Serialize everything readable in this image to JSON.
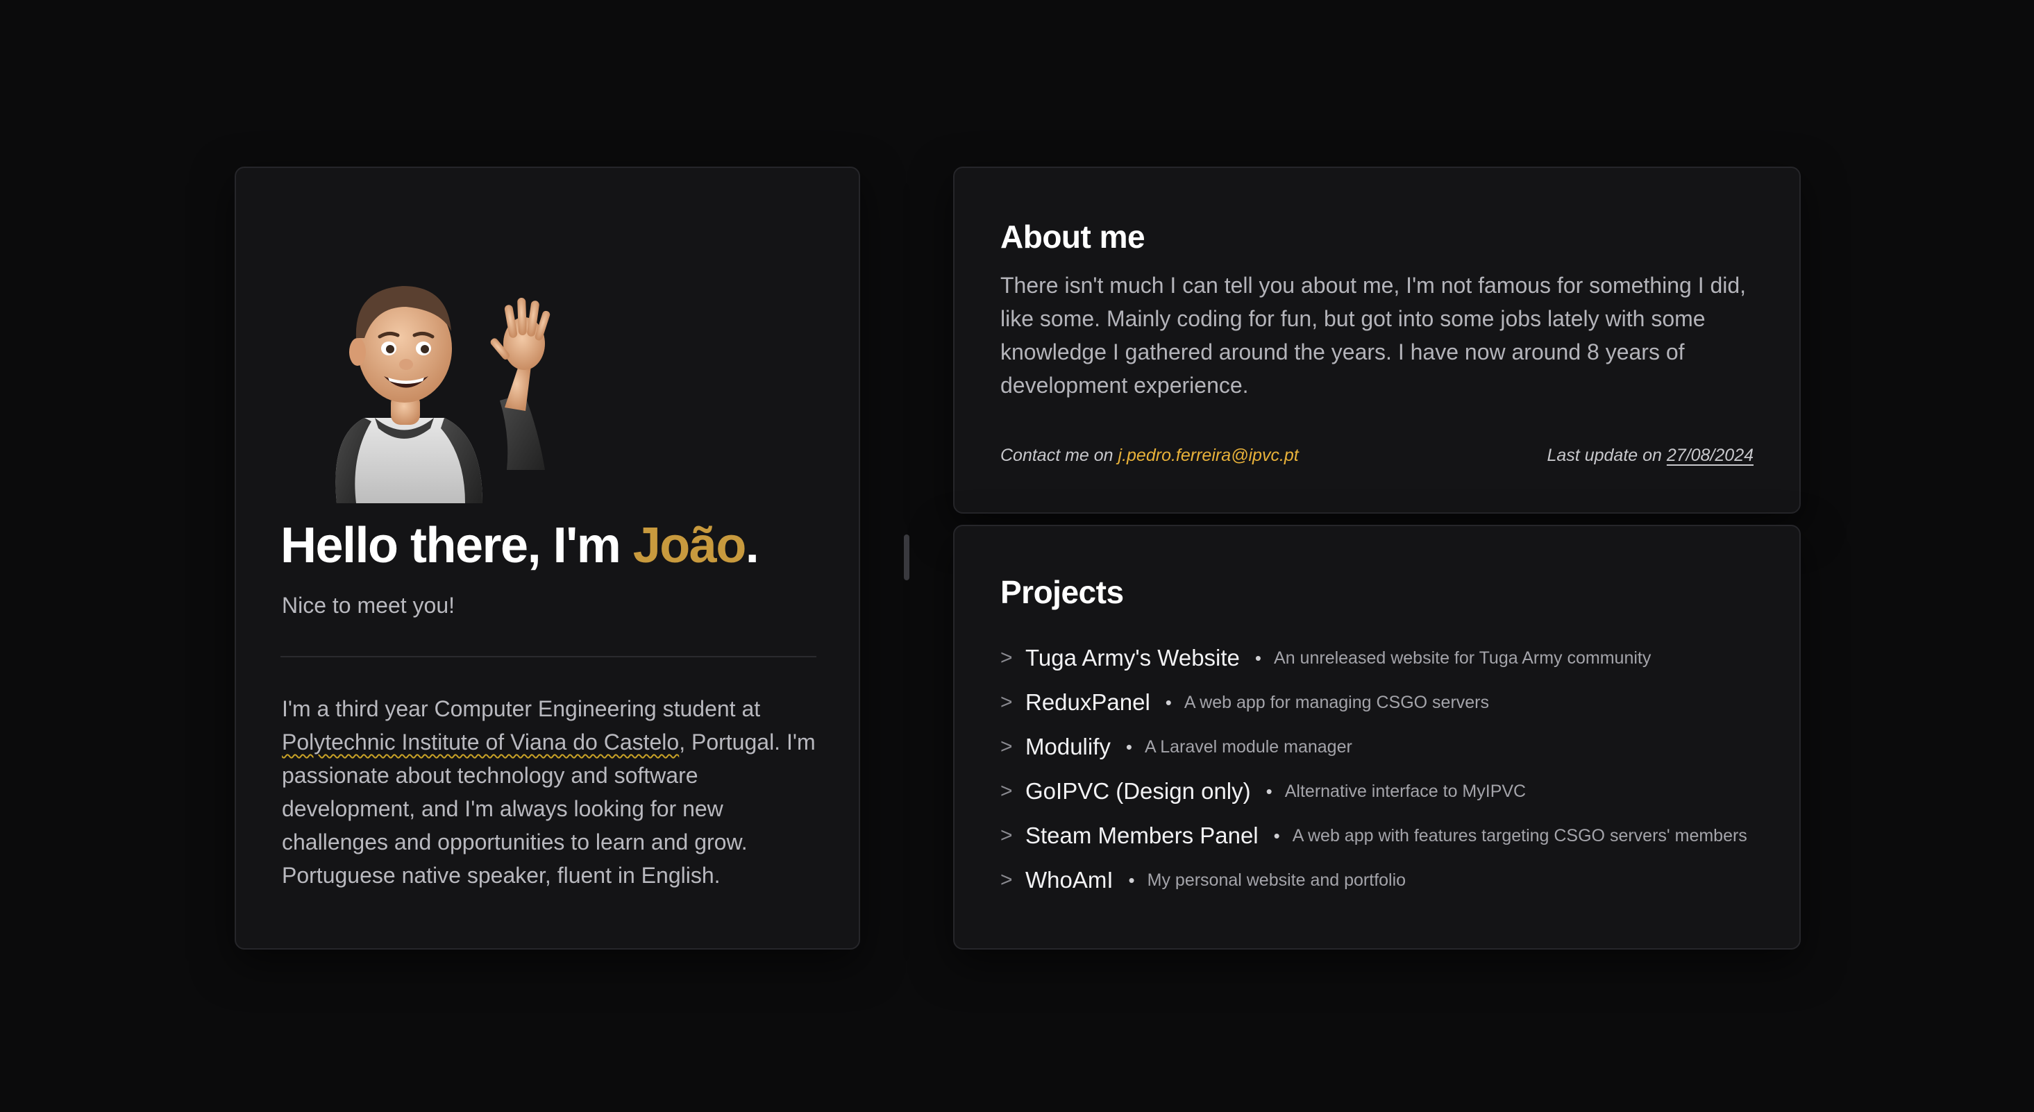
{
  "intro": {
    "greeting": "Hello there, I'm ",
    "name": "João",
    "period": ".",
    "subtitle": "Nice to meet you!",
    "bio_before": "I'm a third year Computer Engineering student at ",
    "bio_link": "Polytechnic Institute of Viana do Castelo",
    "bio_after": ", Portugal. I'm passionate about technology and software development, and I'm always looking for new challenges and opportunities to learn and grow. Portuguese native speaker, fluent in English."
  },
  "about": {
    "title": "About me",
    "text": "There isn't much I can tell you about me, I'm not famous for something I did, like some. Mainly coding for fun, but got into some jobs lately with some knowledge I gathered around the years. I have now around 8 years of development experience.",
    "contact_label": "Contact me on ",
    "email": "j.pedro.ferreira@ipvc.pt",
    "update_label": "Last update on ",
    "update_date": "27/08/2024"
  },
  "projects": {
    "title": "Projects",
    "items": [
      {
        "name": "Tuga Army's Website",
        "description": "An unreleased website for Tuga Army community"
      },
      {
        "name": "ReduxPanel",
        "description": "A web app for managing CSGO servers"
      },
      {
        "name": "Modulify",
        "description": "A Laravel module manager"
      },
      {
        "name": "GoIPVC (Design only)",
        "description": "Alternative interface to MyIPVC"
      },
      {
        "name": "Steam Members Panel",
        "description": "A web app with features targeting CSGO servers' members"
      },
      {
        "name": "WhoAmI",
        "description": "My personal website and portfolio"
      }
    ]
  },
  "colors": {
    "accent_name": "#c89a3e",
    "accent_email": "#e9b23a",
    "background": "#0b0b0c",
    "card": "#141416"
  },
  "icons": {
    "avatar": "waving-memoji-avatar",
    "project_bullet": "chevron-right-icon"
  }
}
